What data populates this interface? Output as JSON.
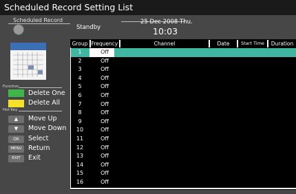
{
  "title": "Scheduled Record Setting List",
  "header": {
    "scheduled_record_label": "Scheduled Record",
    "status": "Standby",
    "date": "25 Dec 2008 Thu.",
    "time": "10:03"
  },
  "thumbnail": {
    "title": "SCHEDULE"
  },
  "function": {
    "label": "Function",
    "delete_one": "Delete One",
    "delete_all": "Delete All",
    "delete_one_color": "#3fb54a",
    "delete_all_color": "#f3e12a"
  },
  "hotkey": {
    "label": "Hot Key",
    "move_up": "Move Up",
    "move_down": "Move Down",
    "ok_key": "OK",
    "select": "Select",
    "menu_key": "MENU",
    "return": "Return",
    "exit_key": "EXIT",
    "exit": "Exit"
  },
  "table": {
    "headers": {
      "group": "Group",
      "frequency": "Frequency",
      "channel": "Channel",
      "date": "Date",
      "start_time": "Start Time",
      "duration": "Duration"
    },
    "rows": [
      {
        "group": "1",
        "frequency": "Off"
      },
      {
        "group": "2",
        "frequency": "Off"
      },
      {
        "group": "3",
        "frequency": "Off"
      },
      {
        "group": "4",
        "frequency": "Off"
      },
      {
        "group": "5",
        "frequency": "Off"
      },
      {
        "group": "6",
        "frequency": "Off"
      },
      {
        "group": "7",
        "frequency": "Off"
      },
      {
        "group": "8",
        "frequency": "Off"
      },
      {
        "group": "9",
        "frequency": "Off"
      },
      {
        "group": "10",
        "frequency": "Off"
      },
      {
        "group": "11",
        "frequency": "Off"
      },
      {
        "group": "12",
        "frequency": "Off"
      },
      {
        "group": "13",
        "frequency": "Off"
      },
      {
        "group": "14",
        "frequency": "Off"
      },
      {
        "group": "15",
        "frequency": "Off"
      },
      {
        "group": "16",
        "frequency": "Off"
      }
    ],
    "selected_row": 1,
    "highlight_color": "#3fb5a2"
  }
}
